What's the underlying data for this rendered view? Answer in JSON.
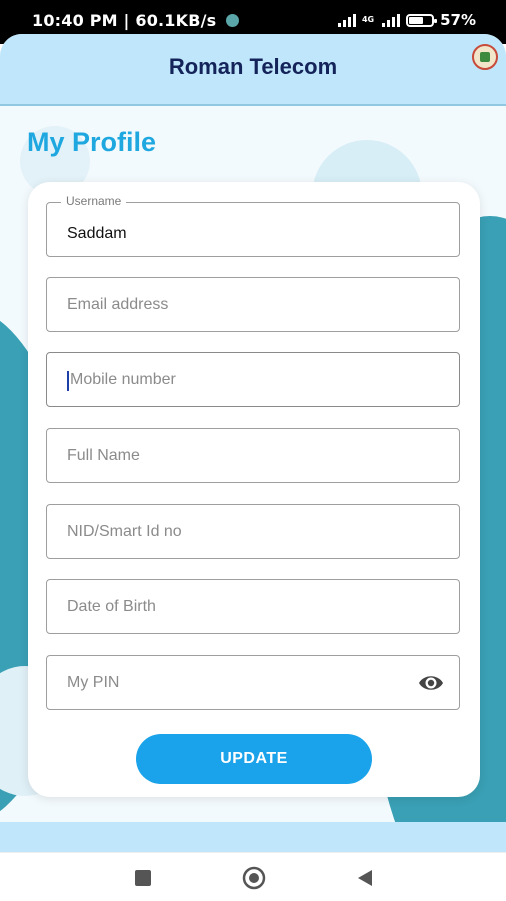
{
  "status_bar": {
    "time": "10:40 PM",
    "separator": "|",
    "speed": "60.1KB/s",
    "network_label": "4G",
    "battery_percent": "57%",
    "battery_level": 0.57
  },
  "app_bar": {
    "title": "Roman Telecom",
    "logo_icon": "app-logo-icon"
  },
  "page": {
    "title": "My Profile"
  },
  "form": {
    "username": {
      "label": "Username",
      "value": "Saddam"
    },
    "email": {
      "placeholder": "Email address"
    },
    "mobile": {
      "placeholder": "Mobile number"
    },
    "full_name": {
      "placeholder": "Full Name"
    },
    "nid": {
      "placeholder": "NID/Smart Id no"
    },
    "dob": {
      "placeholder": "Date of Birth"
    },
    "pin": {
      "placeholder": "My PIN",
      "toggle_icon": "eye-icon"
    }
  },
  "actions": {
    "update_label": "UPDATE"
  },
  "nav": {
    "recent_icon": "square-icon",
    "home_icon": "circle-home-icon",
    "back_icon": "triangle-back-icon"
  },
  "colors": {
    "accent": "#1aa3ea",
    "title_blue": "#1fa8e0",
    "appbar_bg": "#bfe6fa",
    "app_title": "#14245a",
    "blob": "#3aa0b5"
  }
}
